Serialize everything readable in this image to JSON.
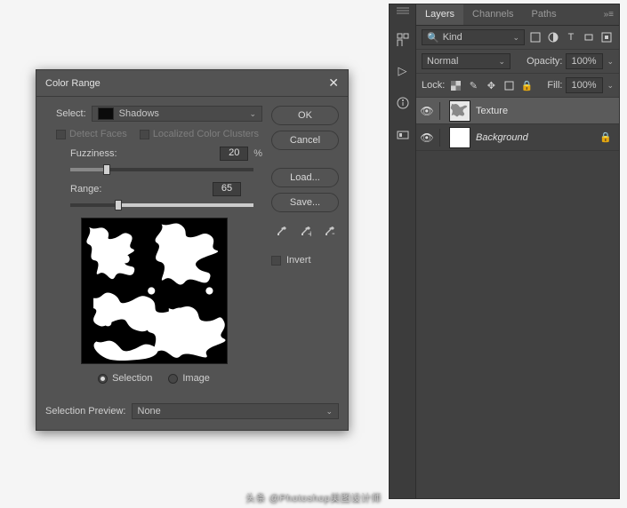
{
  "dialog": {
    "title": "Color Range",
    "select_label": "Select:",
    "select_value": "Shadows",
    "detect_faces": "Detect Faces",
    "localized_clusters": "Localized Color Clusters",
    "fuzziness_label": "Fuzziness:",
    "fuzziness_value": "20",
    "pct": "%",
    "range_label": "Range:",
    "range_value": "65",
    "radio_selection": "Selection",
    "radio_image": "Image",
    "selection_preview_label": "Selection Preview:",
    "selection_preview_value": "None",
    "ok": "OK",
    "cancel": "Cancel",
    "load": "Load...",
    "save": "Save...",
    "invert": "Invert"
  },
  "panel": {
    "tabs": [
      "Layers",
      "Channels",
      "Paths"
    ],
    "filter_label": "Kind",
    "blend_mode": "Normal",
    "opacity_label": "Opacity:",
    "opacity_value": "100%",
    "lock_label": "Lock:",
    "fill_label": "Fill:",
    "fill_value": "100%",
    "layers": [
      {
        "name": "Texture",
        "selected": true,
        "locked": false,
        "bg": false
      },
      {
        "name": "Background",
        "selected": false,
        "locked": true,
        "bg": true
      }
    ]
  },
  "attribution": "头条 @Photoshop美图设计师"
}
